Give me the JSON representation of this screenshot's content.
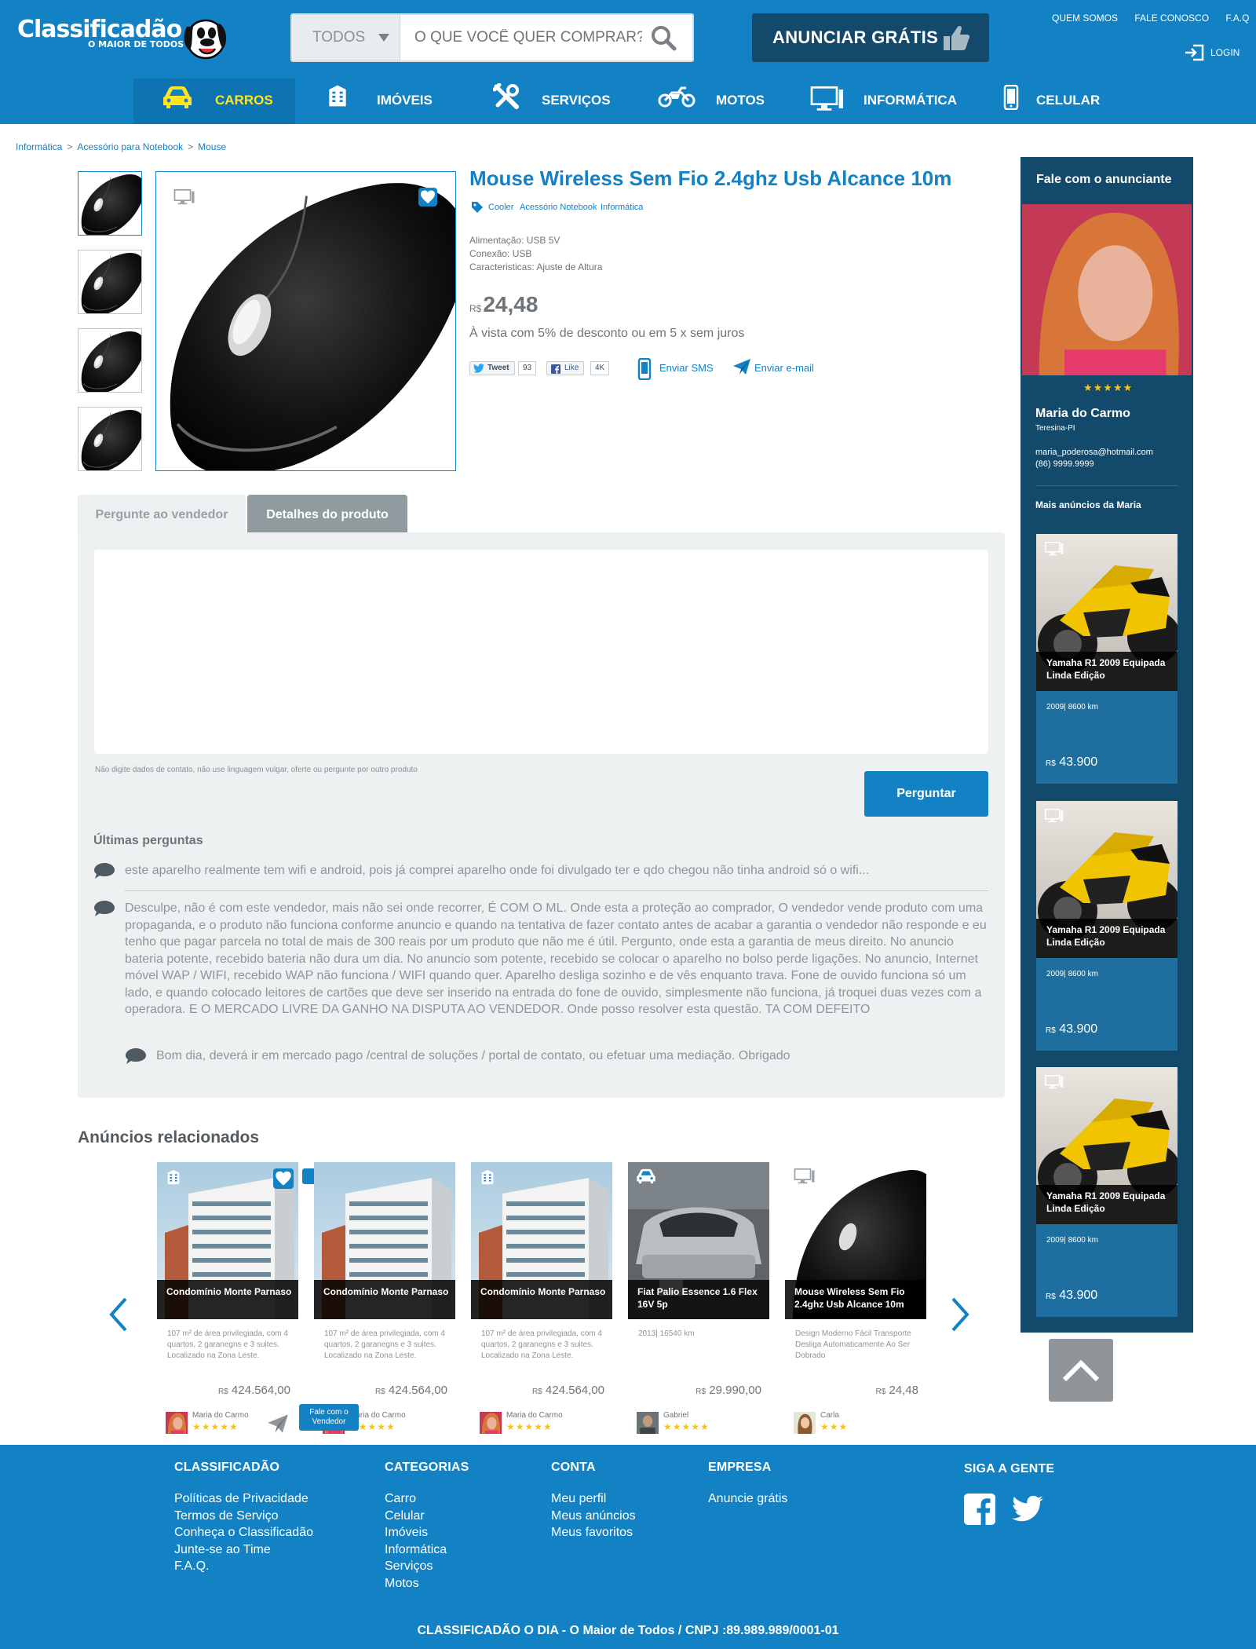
{
  "header": {
    "logo_text": "Classificadão",
    "logo_tagline": "O MAIOR DE TODOS",
    "search": {
      "category": "TODOS",
      "placeholder": "O QUE VOCÊ QUER COMPRAR?"
    },
    "cta_label": "ANUNCIAR GRÁTIS",
    "top_links": [
      "QUEM SOMOS",
      "FALE CONOSCO",
      "F.A.Q"
    ],
    "login_label": "LOGIN",
    "nav": [
      {
        "label": "CARROS",
        "icon": "car-icon",
        "active": true
      },
      {
        "label": "IMÓVEIS",
        "icon": "building-icon"
      },
      {
        "label": "SERVIÇOS",
        "icon": "tools-icon"
      },
      {
        "label": "MOTOS",
        "icon": "motorcycle-icon"
      },
      {
        "label": "INFORMÁTICA",
        "icon": "computer-icon"
      },
      {
        "label": "CELULAR",
        "icon": "phone-icon"
      }
    ]
  },
  "breadcrumb": [
    "Informática",
    "Acessório para Notebook",
    "Mouse"
  ],
  "product": {
    "title": "Mouse Wireless Sem Fio 2.4ghz Usb Alcance 10m",
    "tags": [
      "Cooler",
      "Acessório Notebook",
      "Informática"
    ],
    "specs": [
      "Alimentação: USB 5V",
      "Conexão: USB",
      "Caracteristicas: Ajuste de Altura"
    ],
    "currency": "R$",
    "price": "24,48",
    "payment_note": "À vista com 5% de desconto ou em 5 x sem juros",
    "social": {
      "tweet_label": "Tweet",
      "tweet_count": "93",
      "like_label": "Like",
      "like_count": "4K",
      "sms_label": "Enviar SMS",
      "email_label": "Enviar e-mail"
    }
  },
  "tabs": [
    "Pergunte ao vendedor",
    "Detalhes do produto"
  ],
  "question_form": {
    "hint": "Não digite dados de contato, não use linguagem vulgar, oferte ou pergunte por outro produto",
    "button_label": "Perguntar"
  },
  "questions": {
    "title": "Últimas perguntas",
    "items": [
      "este aparelho realmente tem wifi e android, pois já comprei aparelho onde foi divulgado ter e qdo chegou não tinha android só o wifi...",
      "Desculpe, não é com este vendedor, mais não sei onde recorrer, É COM O ML. Onde esta a proteção ao comprador, O vendedor vende produto com uma propaganda, e o produto não funciona conforme anuncio e quando na tentativa de fazer contato antes de acabar a garantia o vendedor não responde e eu tenho que pagar parcela no total de mais de 300 reais por um produto que não me é útil. Pergunto, onde esta a garantia de meus direito. No anuncio bateria potente, recebido bateria não dura um dia. No anuncio som potente, recebido se colocar o aparelho no bolso perde ligações. No anuncio, Internet móvel WAP / WIFI, recebido WAP não funciona / WIFI quando quer. Aparelho desliga sozinho e de vês enquanto trava. Fone de ouvido funciona só um lado, e quando colocado leitores de cartões que deve ser inserido na entrada do fone de ouvido, simplesmente não funciona, já troquei duas vezes com a operadora. E O MERCADO LIVRE DA GANHO NA DISPUTA AO VENDEDOR. Onde posso resolver esta questão. TA COM DEFEITO"
    ],
    "reply": "Bom dia, deverá ir em mercado pago /central de soluções / portal de contato, ou efetuar uma mediação. Obrigado"
  },
  "seller": {
    "header": "Fale com o anunciante",
    "rating_stars": 5,
    "name": "Maria do Carmo",
    "city": "Teresina-PI",
    "email": "maria_poderosa@hotmail.com",
    "phone": "(86) 9999.9999",
    "more_title": "Mais anúncios da Maria",
    "ads": [
      {
        "title": "Yamaha R1 2009 Equipada Linda Edição",
        "meta": "2009| 8600 km",
        "currency": "R$",
        "price": "43.900"
      },
      {
        "title": "Yamaha R1 2009 Equipada Linda Edição",
        "meta": "2009| 8600 km",
        "currency": "R$",
        "price": "43.900"
      },
      {
        "title": "Yamaha R1 2009 Equipada Linda Edição",
        "meta": "2009| 8600 km",
        "currency": "R$",
        "price": "43.900"
      }
    ]
  },
  "related": {
    "title": "Anúncios relacionados",
    "favorite_tooltip": "Favoritar",
    "contact_tooltip": "Fale com o Vendedor",
    "items": [
      {
        "title": "Condomínio Monte Parnaso",
        "desc": "107 m² de área privilegiada, com 4 quartos, 2 garanegns e 3 suites. Localizado na Zona Leste.",
        "currency": "R$",
        "price": "424.564,00",
        "seller": "Maria do Carmo",
        "stars": 5
      },
      {
        "title": "Condomínio Monte Parnaso",
        "desc": "107 m² de área privilegiada, com 4 quartos, 2 garanegns e 3 suites. Localizado na Zona Leste.",
        "currency": "R$",
        "price": "424.564,00",
        "seller": "Maria do Carmo",
        "stars": 5
      },
      {
        "title": "Condomínio Monte Parnaso",
        "desc": "107 m² de área privilegiada, com 4 quartos, 2 garanegns e 3 suites. Localizado na Zona Leste.",
        "currency": "R$",
        "price": "424.564,00",
        "seller": "Maria do Carmo",
        "stars": 5
      },
      {
        "title": "Fiat Palio Essence 1.6 Flex 16V 5p",
        "desc": "2013| 16540 km",
        "currency": "R$",
        "price": "29.990,00",
        "seller": "Gabriel",
        "stars": 5
      },
      {
        "title": "Mouse Wireless Sem Fio 2.4ghz Usb Alcance 10m",
        "desc": "Design Moderno Fácil Transporte Desliga Automaticamente Ao Ser Dobrado",
        "currency": "R$",
        "price": "24,48",
        "seller": "Carla",
        "stars": 3
      }
    ]
  },
  "footer": {
    "columns": [
      {
        "title": "CLASSIFICADÃO",
        "links": [
          "Políticas de Privacidade",
          "Termos de Serviço",
          "Conheça o Classificadão",
          "Junte-se ao Time",
          "F.A.Q."
        ]
      },
      {
        "title": "CATEGORIAS",
        "links": [
          "Carro",
          "Celular",
          "Imóveis",
          "Informática",
          "Serviços",
          "Motos"
        ]
      },
      {
        "title": "CONTA",
        "links": [
          "Meu perfil",
          "Meus anúncios",
          "Meus favoritos"
        ]
      },
      {
        "title": "EMPRESA",
        "links": [
          "Anuncie grátis"
        ]
      }
    ],
    "social_title": "SIGA A GENTE",
    "copyright": "CLASSIFICADÃO O DIA - O Maior de Todos / CNPJ :89.989.989/0001-01"
  },
  "colors": {
    "brand_blue": "#1382c5",
    "dark_navy": "#134a6b",
    "card_blue": "#1e6f9f",
    "accent_yellow": "#ffe51f",
    "star_gold": "#f8c31b"
  }
}
